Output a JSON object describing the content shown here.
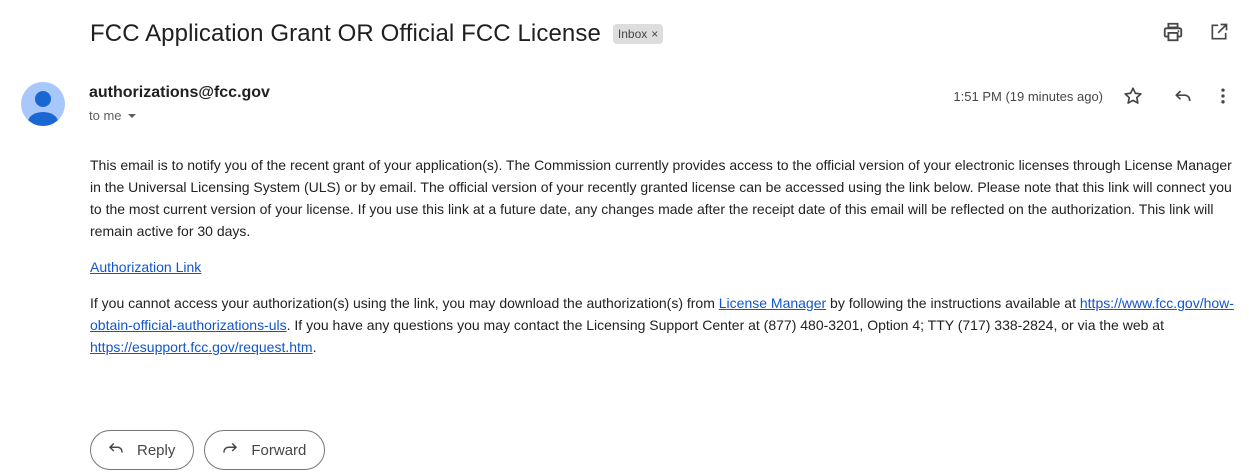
{
  "email": {
    "subject": "FCC Application Grant OR Official FCC License",
    "label": "Inbox",
    "label_remove": "×",
    "sender": "authorizations@fcc.gov",
    "recipient": "to me",
    "timestamp": "1:51 PM (19 minutes ago)",
    "body": {
      "paragraph1": "This email is to notify you of the recent grant of your application(s). The Commission currently provides access to the official version of your electronic licenses through License Manager in the Universal Licensing System (ULS) or by email. The official version of your recently granted license can be accessed using the link below. Please note that this link will connect you to the most current version of your license. If you use this link at a future date, any changes made after the receipt date of this email will be reflected on the authorization. This link will remain active for 30 days.",
      "auth_link": "Authorization Link",
      "p2_part1": "If you cannot access your authorization(s) using the link, you may download the authorization(s) from ",
      "license_manager_link": "License Manager",
      "p2_part2": " by following the instructions available at ",
      "fcc_link": "https://www.fcc.gov/how-obtain-official-authorizations-uls",
      "p2_part3": ". If you have any questions you may contact the Licensing Support Center at (877) 480-3201, Option 4; TTY (717) 338-2824, or via the web at ",
      "esupport_link": "https://esupport.fcc.gov/request.htm",
      "p2_part4": "."
    }
  },
  "actions": {
    "reply_label": "Reply",
    "forward_label": "Forward"
  },
  "icons": {
    "print": "print-icon",
    "open_new": "open-in-new-window-icon",
    "star": "star-icon",
    "reply": "reply-icon",
    "more": "more-vert-icon",
    "caret": "caret-down-icon",
    "forward": "forward-icon"
  },
  "colors": {
    "avatar_bg": "#a8c7fa",
    "avatar_fg": "#1967d2",
    "link": "#1155cc",
    "label_bg": "#dddddd"
  }
}
